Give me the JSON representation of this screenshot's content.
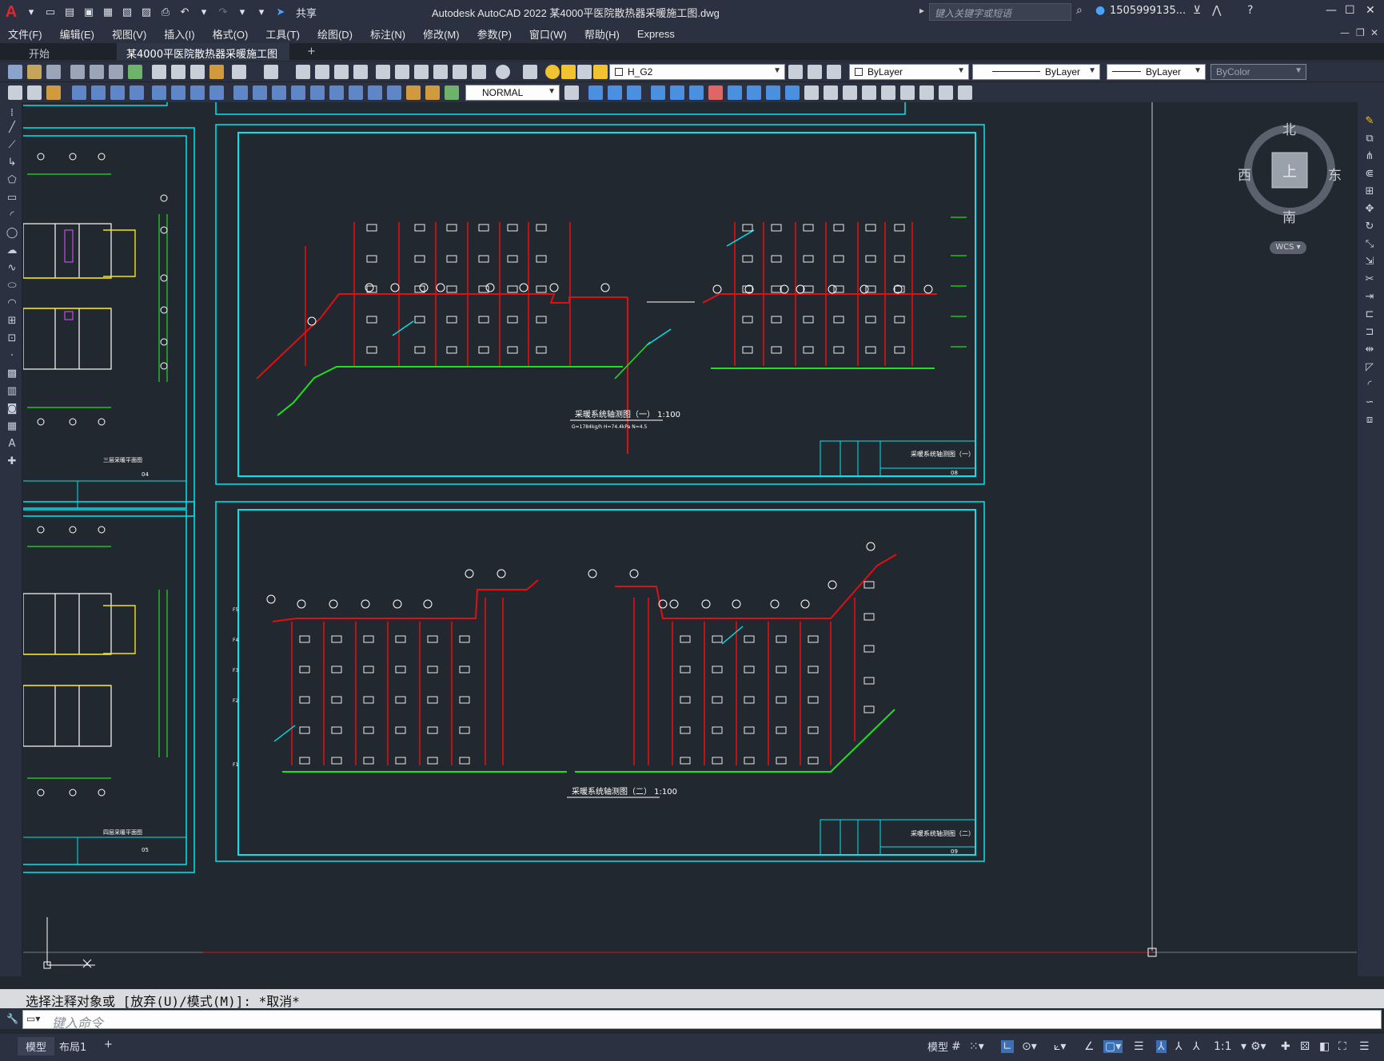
{
  "app": {
    "logo": "A",
    "title": "Autodesk AutoCAD 2022    某4000平医院散热器采暖施工图.dwg",
    "share_label": "共享",
    "search_placeholder": "键入关键字或短语",
    "user": "1505999135...",
    "help": "?"
  },
  "menus": [
    "文件(F)",
    "编辑(E)",
    "视图(V)",
    "插入(I)",
    "格式(O)",
    "工具(T)",
    "绘图(D)",
    "标注(N)",
    "修改(M)",
    "参数(P)",
    "窗口(W)",
    "帮助(H)",
    "Express"
  ],
  "tabs": {
    "start": "开始",
    "document": "某4000平医院散热器采暖施工图*",
    "close": "×",
    "add": "+"
  },
  "properties": {
    "layer": "H_G2",
    "color": "ByLayer",
    "linetype": "ByLayer",
    "lineweight": "ByLayer",
    "plotstyle": "ByColor",
    "dimstyle": "NORMAL"
  },
  "viewcube": {
    "north": "北",
    "south": "南",
    "east": "东",
    "west": "西",
    "face": "上",
    "wcs": "WCS"
  },
  "drawing": {
    "sheet1_title": "采暖系统轴测图（一）  1:100",
    "sheet1_subtitle": "G=1784kg/h    H=74.4kPa    N=4.5",
    "sheet1_block_title": "采暖系统轴测图（一）",
    "sheet1_number": "08",
    "sheet2_title": "采暖系统轴测图（二）  1:100",
    "sheet2_block_title": "采暖系统轴测图（二）",
    "sheet2_number": "09",
    "left1_block_title": "三层采暖平面图",
    "left1_number": "04",
    "left2_block_title": "四层采暖平面图",
    "left2_number": "05",
    "floor_labels": [
      "F5",
      "F4",
      "F3",
      "F2",
      "F1"
    ]
  },
  "command": {
    "history": "选择注释对象或 [放弃(U)/模式(M)]: *取消*",
    "placeholder": "键入命令"
  },
  "status": {
    "model_tab": "模型",
    "layout_tab": "布局1",
    "add": "+",
    "model_btn": "模型",
    "scale": "1:1"
  },
  "colors": {
    "accent_cyan": "#00e5ee",
    "pipe_red": "#e01010",
    "pipe_green": "#20e020",
    "radiator_white": "#ffffff",
    "background": "#212830"
  }
}
